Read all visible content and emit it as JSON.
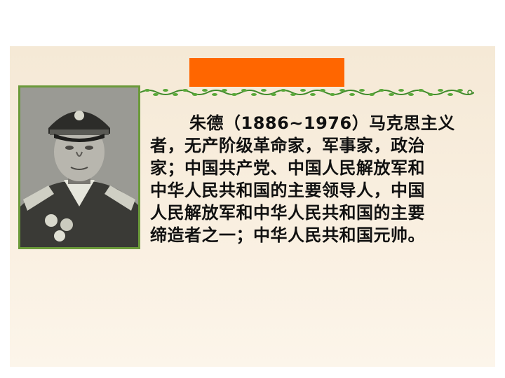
{
  "slide": {
    "accent_color": "#ff6600",
    "frame_color": "#6b9a3a",
    "vine_color": "#3f8a2a"
  },
  "photo": {
    "subject": "portrait photograph of a man in military uniform"
  },
  "body": {
    "lines": [
      "朱德（1886~1976）马克思主义",
      "者，无产阶级革命家，军事家，政治",
      "家；中国共产党、中国人民解放军和",
      "中华人民共和国的主要领导人，中国",
      "人民解放军和中华人民共和国的主要",
      "缔造者之一；中华人民共和国元帅。"
    ]
  }
}
